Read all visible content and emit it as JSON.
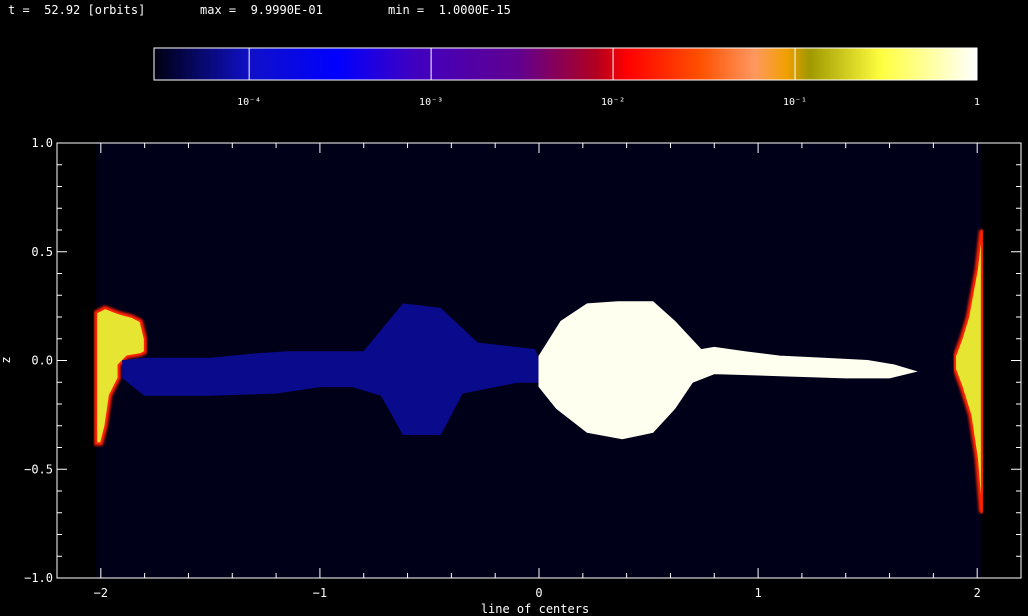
{
  "header": {
    "time_label": "t =",
    "time_value": "52.92",
    "time_unit": "[orbits]",
    "max_label": "max =",
    "max_value": "9.9990E-01",
    "min_label": "min =",
    "min_value": "1.0000E-15"
  },
  "colorbar": {
    "scale": "log",
    "range": [
      3e-05,
      1
    ],
    "tick_values": [
      0.0001,
      0.001,
      0.01,
      0.1,
      1
    ],
    "tick_labels": [
      "10⁻⁴",
      "10⁻³",
      "10⁻²",
      "10⁻¹",
      "1"
    ],
    "colors": [
      {
        "v": 3e-05,
        "color": "#000010"
      },
      {
        "v": 0.0001,
        "color": "#1010c8"
      },
      {
        "v": 0.0003,
        "color": "#0000ff"
      },
      {
        "v": 0.0008,
        "color": "#4000c0"
      },
      {
        "v": 0.003,
        "color": "#600090"
      },
      {
        "v": 0.008,
        "color": "#b00020"
      },
      {
        "v": 0.012,
        "color": "#ff0000"
      },
      {
        "v": 0.03,
        "color": "#ff5000"
      },
      {
        "v": 0.06,
        "color": "#ff9860"
      },
      {
        "v": 0.09,
        "color": "#f0a000"
      },
      {
        "v": 0.12,
        "color": "#a09800"
      },
      {
        "v": 0.3,
        "color": "#ffff40"
      },
      {
        "v": 1,
        "color": "#ffffff"
      }
    ]
  },
  "chart_data": {
    "type": "heatmap",
    "xlabel": "line of centers",
    "ylabel": "z",
    "xlim": [
      -2.2,
      2.2
    ],
    "ylim": [
      -1.0,
      1.0
    ],
    "xticks": [
      -2,
      -1,
      0,
      1,
      2
    ],
    "xtick_labels": [
      "−2",
      "−1",
      "0",
      "1",
      "2"
    ],
    "yticks": [
      -1.0,
      -0.5,
      0.0,
      0.5,
      1.0
    ],
    "ytick_labels": [
      "−1.0",
      "−0.5",
      "0.0",
      "0.5",
      "1.0"
    ],
    "grid": false,
    "background_color": "#000018",
    "data_extent_x": [
      -2.02,
      2.02
    ],
    "features": [
      {
        "name": "left-star",
        "color": "#e6e632",
        "value_approx": 0.3,
        "edge_color": "#ff2000",
        "outline": [
          [
            -2.02,
            0.22
          ],
          [
            -1.98,
            0.24
          ],
          [
            -1.93,
            0.22
          ],
          [
            -1.9,
            0.21
          ],
          [
            -1.86,
            0.2
          ],
          [
            -1.82,
            0.18
          ],
          [
            -1.8,
            0.1
          ],
          [
            -1.8,
            0.04
          ],
          [
            -1.82,
            0.03
          ],
          [
            -1.88,
            0.02
          ],
          [
            -1.92,
            -0.02
          ],
          [
            -1.92,
            -0.08
          ],
          [
            -1.96,
            -0.16
          ],
          [
            -1.98,
            -0.3
          ],
          [
            -2.0,
            -0.38
          ],
          [
            -2.02,
            -0.38
          ]
        ]
      },
      {
        "name": "stream",
        "color": "#0a0a8c",
        "value_approx": 0.0001,
        "outline": [
          [
            -1.9,
            0.0
          ],
          [
            -1.8,
            0.01
          ],
          [
            -1.5,
            0.01
          ],
          [
            -1.3,
            0.03
          ],
          [
            -1.15,
            0.04
          ],
          [
            -1.0,
            0.04
          ],
          [
            -0.8,
            0.04
          ],
          [
            -0.62,
            0.26
          ],
          [
            -0.45,
            0.24
          ],
          [
            -0.28,
            0.08
          ],
          [
            -0.02,
            0.05
          ],
          [
            0.0,
            0.0
          ],
          [
            0.0,
            -0.1
          ],
          [
            -0.1,
            -0.1
          ],
          [
            -0.35,
            -0.15
          ],
          [
            -0.45,
            -0.34
          ],
          [
            -0.62,
            -0.34
          ],
          [
            -0.72,
            -0.16
          ],
          [
            -0.85,
            -0.12
          ],
          [
            -1.0,
            -0.12
          ],
          [
            -1.2,
            -0.15
          ],
          [
            -1.5,
            -0.16
          ],
          [
            -1.8,
            -0.16
          ],
          [
            -1.9,
            -0.08
          ]
        ]
      },
      {
        "name": "accretor",
        "color": "#fffff0",
        "value_approx": 1.0,
        "outline": [
          [
            0.0,
            0.02
          ],
          [
            0.1,
            0.18
          ],
          [
            0.22,
            0.26
          ],
          [
            0.36,
            0.27
          ],
          [
            0.52,
            0.27
          ],
          [
            0.62,
            0.18
          ],
          [
            0.74,
            0.05
          ],
          [
            0.8,
            0.06
          ],
          [
            0.94,
            0.04
          ],
          [
            1.1,
            0.02
          ],
          [
            1.3,
            0.01
          ],
          [
            1.5,
            0.0
          ],
          [
            1.62,
            -0.02
          ],
          [
            1.72,
            -0.05
          ],
          [
            1.6,
            -0.08
          ],
          [
            1.4,
            -0.08
          ],
          [
            1.1,
            -0.07
          ],
          [
            0.8,
            -0.06
          ],
          [
            0.7,
            -0.1
          ],
          [
            0.62,
            -0.22
          ],
          [
            0.52,
            -0.33
          ],
          [
            0.38,
            -0.36
          ],
          [
            0.22,
            -0.33
          ],
          [
            0.08,
            -0.22
          ],
          [
            0.0,
            -0.12
          ]
        ]
      },
      {
        "name": "right-star",
        "color": "#e6e632",
        "value_approx": 0.3,
        "edge_color": "#ff2000",
        "outline": [
          [
            2.02,
            0.6
          ],
          [
            2.0,
            0.42
          ],
          [
            1.96,
            0.2
          ],
          [
            1.93,
            0.1
          ],
          [
            1.9,
            0.02
          ],
          [
            1.9,
            -0.04
          ],
          [
            1.93,
            -0.12
          ],
          [
            1.97,
            -0.25
          ],
          [
            2.0,
            -0.45
          ],
          [
            2.02,
            -0.7
          ]
        ]
      }
    ]
  }
}
